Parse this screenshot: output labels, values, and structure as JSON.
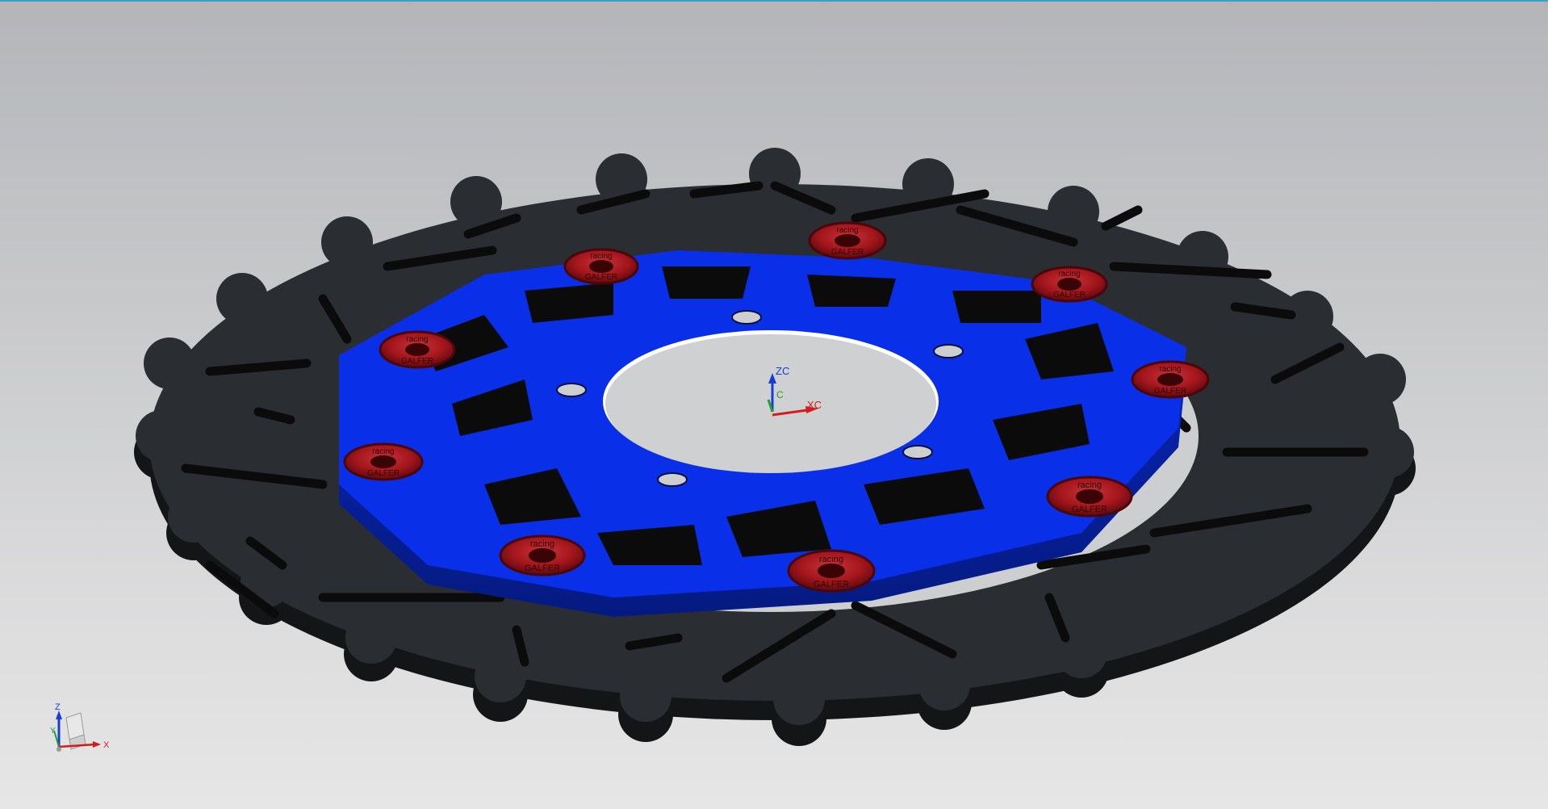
{
  "model": {
    "name": "",
    "rotor_color": "#2a2e33",
    "carrier_color": "#0a2fe8",
    "button_color": "#a3161c",
    "button_count": 9
  },
  "button_text": {
    "line_top": "racing",
    "line_bottom": "GALFER"
  },
  "work_csys": {
    "z_label": "ZC",
    "y_label": "C",
    "x_label": "XC",
    "z_color": "#1a3cd6",
    "y_color": "#22a02a",
    "x_color": "#d21d1d"
  },
  "abs_triad": {
    "z_label": "Z",
    "y_label": "Y",
    "x_label": "X"
  },
  "colors": {
    "bg_top": "#b4b5b8",
    "bg_bottom": "#e6e6e6",
    "accent_border": "#3aa0c8"
  }
}
